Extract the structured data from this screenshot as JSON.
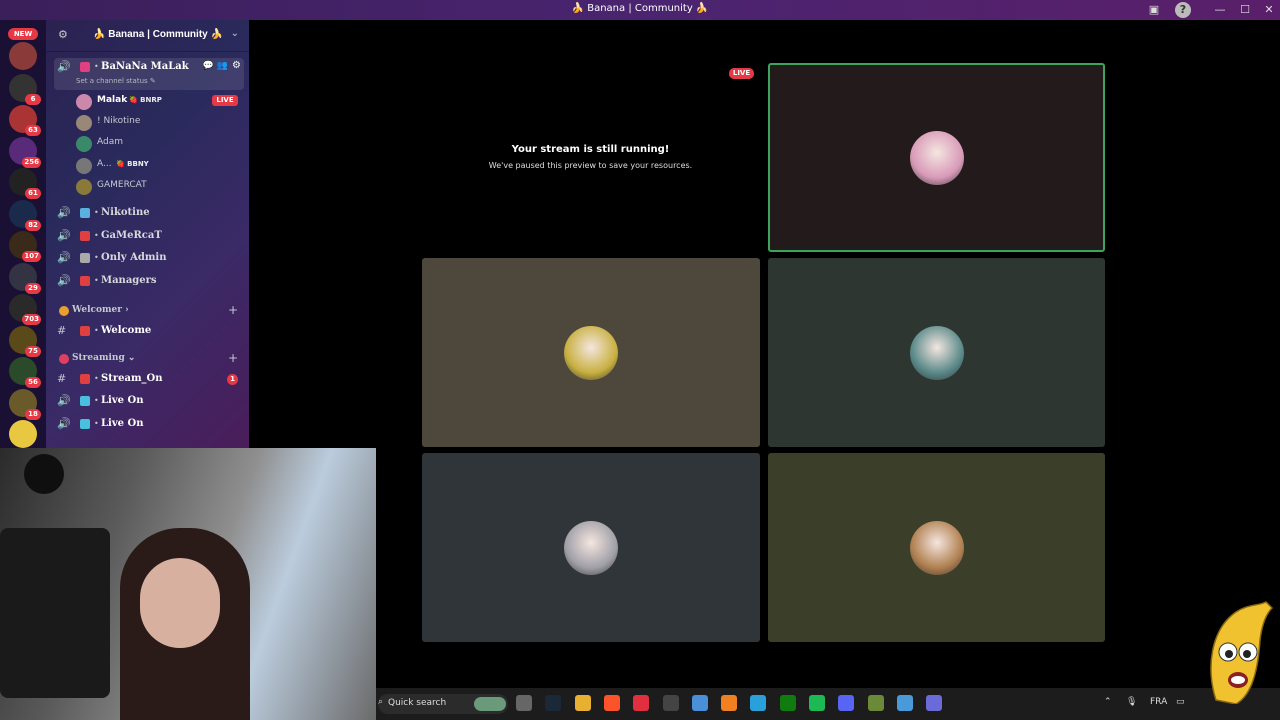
{
  "window": {
    "title": "🍌 Banana | Community 🍌",
    "controls": {
      "minimize": "—",
      "maximize": "☐",
      "close": "✕"
    }
  },
  "server_rail": {
    "new_label": "NEW",
    "servers": [
      {
        "badge": "",
        "color": "#8b3a3a"
      },
      {
        "badge": "6",
        "color": "#333"
      },
      {
        "badge": "63",
        "color": "#a33"
      },
      {
        "badge": "256",
        "color": "#5a2a7a"
      },
      {
        "badge": "61",
        "color": "#222"
      },
      {
        "badge": "82",
        "color": "#1a2a4a"
      },
      {
        "badge": "107",
        "color": "#3a2a1a"
      },
      {
        "badge": "29",
        "color": "#334"
      },
      {
        "badge": "703",
        "color": "#2a2a2a"
      },
      {
        "badge": "75",
        "color": "#5a4a1a"
      },
      {
        "badge": "56",
        "color": "#2a4a2a"
      },
      {
        "badge": "18",
        "color": "#6a5a2a"
      },
      {
        "badge": "",
        "color": "#e8c840"
      }
    ]
  },
  "server": {
    "name": "🍌 Banana | Community 🍌",
    "current_channel": {
      "name": "BaNaNa MaLak",
      "status_hint": "Set a channel status ✎",
      "members": [
        {
          "name": "Malak",
          "tag": "🍓 BNRP",
          "live": "LIVE",
          "avatar_color": "#c8a"
        },
        {
          "name": "! Nikotine",
          "tag": "",
          "live": "",
          "avatar_color": "#998877"
        },
        {
          "name": "Adam",
          "tag": "",
          "live": "",
          "avatar_color": "#3a8a6a"
        },
        {
          "name": "A...",
          "tag": "🍓 BBNY",
          "live": "",
          "avatar_color": "#777"
        },
        {
          "name": "GAMERCAT",
          "tag": "",
          "live": "",
          "avatar_color": "#8a7a3a"
        }
      ]
    },
    "voice_channels": [
      {
        "name": "Nikotine",
        "emoji_color": "#5ab0e0"
      },
      {
        "name": "GaMeRcaT",
        "emoji_color": "#e04040"
      },
      {
        "name": "Only Admin",
        "emoji_color": "#aaa"
      },
      {
        "name": "Managers",
        "emoji_color": "#e04040"
      }
    ],
    "categories": [
      {
        "name": "Welcomer ›",
        "channels": [
          {
            "name": "Welcome",
            "emoji_color": "#e04040"
          }
        ]
      },
      {
        "name": "Streaming ⌄",
        "channels": [
          {
            "name": "Stream_On",
            "badge": "1",
            "emoji_color": "#e04040",
            "type": "text"
          },
          {
            "name": "Live On",
            "emoji_color": "#4ac0e0",
            "type": "voice"
          },
          {
            "name": "Live On",
            "emoji_color": "#4ac0e0",
            "type": "voice"
          }
        ]
      }
    ]
  },
  "stage": {
    "live_label": "LIVE",
    "paused_title": "Your stream is still running!",
    "paused_subtitle": "We've paused this preview to save your resources.",
    "tiles": [
      {
        "bg": "#231b1b",
        "avatar": "#d89ab8",
        "speaking": true
      },
      {
        "bg": "#4e473c",
        "avatar": "#c8b040",
        "speaking": false
      },
      {
        "bg": "#2e3632",
        "avatar": "#5a8a8a",
        "speaking": false
      },
      {
        "bg": "#30353a",
        "avatar": "#a0a0a8",
        "speaking": false
      },
      {
        "bg": "#3b3f2a",
        "avatar": "#b08050",
        "speaking": false
      }
    ]
  },
  "taskbar": {
    "search_placeholder": "Quick search",
    "language": "FRA",
    "apps": [
      "task-view",
      "steam",
      "file-explorer",
      "brave",
      "opera-gx",
      "obs",
      "chrome",
      "vlc",
      "telegram",
      "xbox",
      "media-player",
      "discord",
      "app-round",
      "photos",
      "app-store"
    ]
  }
}
